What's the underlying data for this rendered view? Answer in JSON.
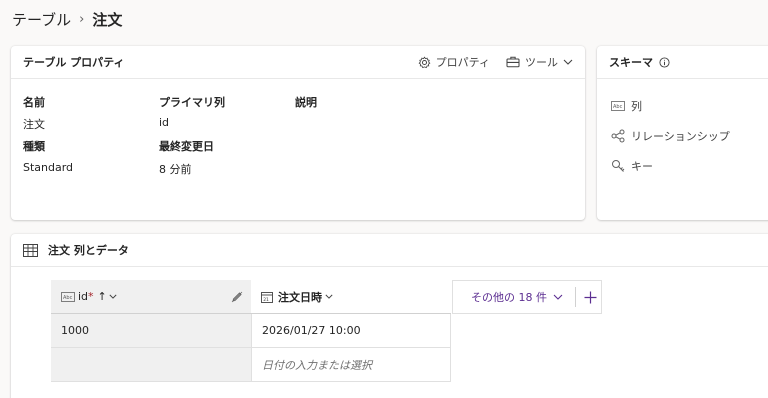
{
  "breadcrumb": {
    "root": "テーブル",
    "current": "注文"
  },
  "properties_card": {
    "title": "テーブル プロパティ",
    "properties_button": "プロパティ",
    "tools_button": "ツール",
    "fields": {
      "name_label": "名前",
      "name_value": "注文",
      "primary_col_label": "プライマリ列",
      "primary_col_value": "id",
      "description_label": "説明",
      "type_label": "種類",
      "type_value": "Standard",
      "modified_label": "最終変更日",
      "modified_value": "8 分前"
    }
  },
  "schema_card": {
    "title": "スキーマ",
    "items": [
      {
        "label": "列",
        "icon": "text-column-icon"
      },
      {
        "label": "リレーションシップ",
        "icon": "relationship-icon"
      },
      {
        "label": "キー",
        "icon": "key-icon"
      }
    ]
  },
  "data_card": {
    "title": "注文 列とデータ",
    "columns": [
      {
        "label": "id",
        "required_mark": "*",
        "sort_indicator": "↑"
      },
      {
        "label": "注文日時"
      }
    ],
    "more_columns_label": "その他の 18 件",
    "rows": [
      {
        "id": "1000",
        "date": "2026/01/27 10:00"
      },
      {
        "id": "",
        "date_placeholder": "日付の入力または選択"
      }
    ]
  },
  "colors": {
    "accent": "#5c2e91",
    "background": "#faf9f8",
    "card": "#ffffff",
    "grid_header": "#f0f0f0"
  }
}
